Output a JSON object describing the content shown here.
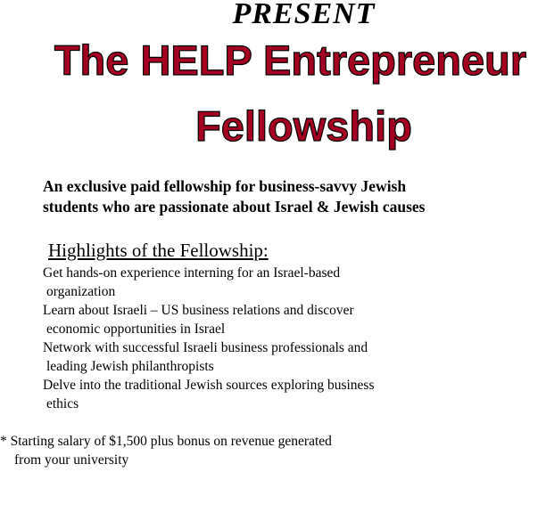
{
  "header": {
    "present": "PRESENT",
    "title_line1": "The HELP Entrepreneur",
    "title_line2": "Fellowship"
  },
  "tagline": {
    "line1": "An exclusive paid fellowship for business-savvy Jewish",
    "line2": "students who are passionate about Israel & Jewish causes"
  },
  "highlights": {
    "heading": "Highlights of  the Fellowship:",
    "items": [
      {
        "line1": "Get hands-on experience interning for an Israel-based",
        "line2": "organization"
      },
      {
        "line1": "Learn about Israeli – US business relations and discover",
        "line2": "economic opportunities in Israel"
      },
      {
        "line1": "Network with successful Israeli business professionals and",
        "line2": "leading Jewish philanthropists"
      },
      {
        "line1": "Delve into the traditional Jewish sources exploring business",
        "line2": "ethics"
      }
    ]
  },
  "footnote": {
    "line1": "* Starting salary of $1,500 plus bonus on revenue generated",
    "line2": "from your university"
  },
  "colors": {
    "title_fill": "#a50021",
    "title_outline": "#000000",
    "text": "#000000",
    "background": "#ffffff"
  }
}
